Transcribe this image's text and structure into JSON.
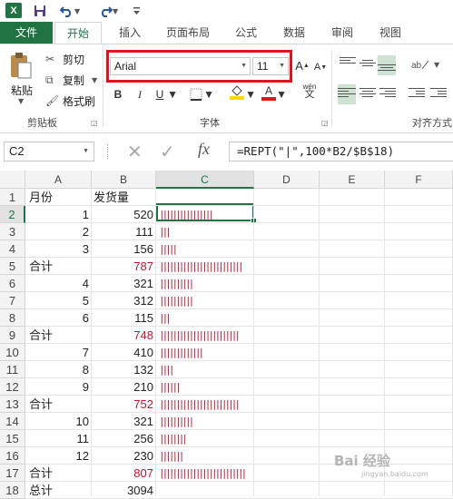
{
  "title_bar": {
    "app_logo": "X",
    "icons": [
      "excel-icon",
      "save-icon",
      "undo-icon",
      "redo-icon",
      "customize-icon"
    ]
  },
  "ribbon_tabs": [
    "文件",
    "开始",
    "插入",
    "页面布局",
    "公式",
    "数据",
    "审阅",
    "视图"
  ],
  "clipboard": {
    "paste_label": "粘贴",
    "cut_label": "剪切",
    "copy_label": "复制",
    "format_painter_label": "格式刷",
    "group_label": "剪贴板"
  },
  "font": {
    "name": "Arial",
    "size": "11",
    "group_label": "字体",
    "bold": "B",
    "italic": "I",
    "underline": "U",
    "grow": "A",
    "shrink": "A",
    "font_color": "A",
    "phonetic_top": "wén",
    "phonetic_bottom": "文"
  },
  "alignment": {
    "group_label": "对齐方式"
  },
  "accent_colors": {
    "excel_green": "#217346",
    "highlight_red": "#e3111b",
    "bar_red": "#c0142e"
  },
  "formula_bar": {
    "name_box": "C2",
    "fx": "fx",
    "formula": "=REPT(\"|\",100*B2/$B$18)"
  },
  "columns": [
    "A",
    "B",
    "C",
    "D",
    "E",
    "F"
  ],
  "rows": [
    {
      "n": "1",
      "a": "月份",
      "b": "发货量",
      "b_red": false,
      "bars": 0
    },
    {
      "n": "2",
      "a": "1",
      "b": "520",
      "b_red": false,
      "bars": 16
    },
    {
      "n": "3",
      "a": "2",
      "b": "111",
      "b_red": false,
      "bars": 3
    },
    {
      "n": "4",
      "a": "3",
      "b": "156",
      "b_red": false,
      "bars": 5
    },
    {
      "n": "5",
      "a": "合计",
      "b": "787",
      "b_red": true,
      "bars": 25
    },
    {
      "n": "6",
      "a": "4",
      "b": "321",
      "b_red": false,
      "bars": 10
    },
    {
      "n": "7",
      "a": "5",
      "b": "312",
      "b_red": false,
      "bars": 10
    },
    {
      "n": "8",
      "a": "6",
      "b": "115",
      "b_red": false,
      "bars": 3
    },
    {
      "n": "9",
      "a": "合计",
      "b": "748",
      "b_red": true,
      "bars": 24
    },
    {
      "n": "10",
      "a": "7",
      "b": "410",
      "b_red": false,
      "bars": 13
    },
    {
      "n": "11",
      "a": "8",
      "b": "132",
      "b_red": false,
      "bars": 4
    },
    {
      "n": "12",
      "a": "9",
      "b": "210",
      "b_red": false,
      "bars": 6
    },
    {
      "n": "13",
      "a": "合计",
      "b": "752",
      "b_red": true,
      "bars": 24
    },
    {
      "n": "14",
      "a": "10",
      "b": "321",
      "b_red": false,
      "bars": 10
    },
    {
      "n": "15",
      "a": "11",
      "b": "256",
      "b_red": false,
      "bars": 8
    },
    {
      "n": "16",
      "a": "12",
      "b": "230",
      "b_red": false,
      "bars": 7
    },
    {
      "n": "17",
      "a": "合计",
      "b": "807",
      "b_red": true,
      "bars": 26
    },
    {
      "n": "18",
      "a": "总计",
      "b": "3094",
      "b_red": false,
      "bars": 0
    }
  ],
  "active_cell": {
    "row": "2",
    "col": "C"
  },
  "watermark": {
    "text": "Bai 经验",
    "sub": "jingyan.baidu.com"
  }
}
